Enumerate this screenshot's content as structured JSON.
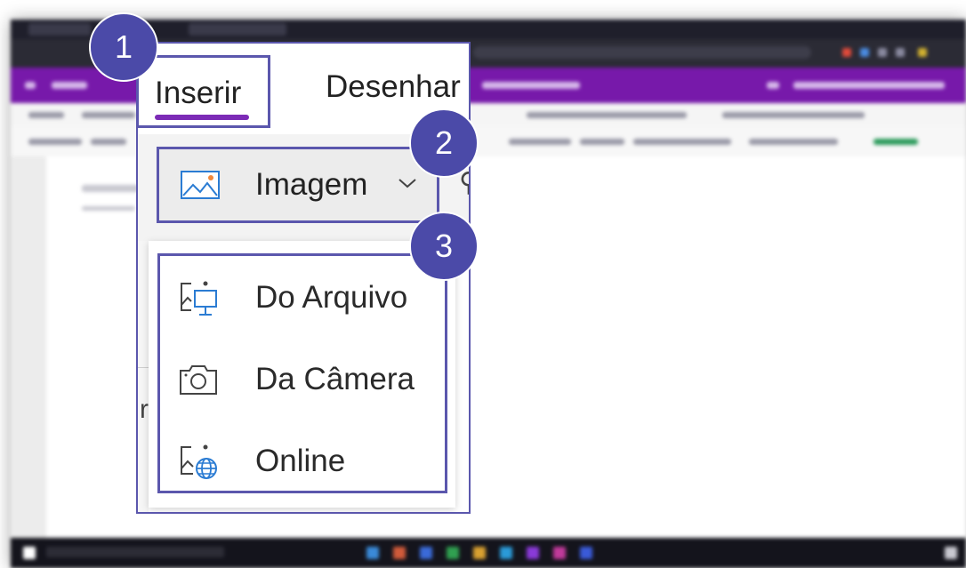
{
  "tabs": {
    "insert_label": "Inserir",
    "draw_label": "Desenhar"
  },
  "ribbon": {
    "image_button_label": "Imagem",
    "image_button_icon": "picture-icon",
    "chevron_icon": "chevron-down-icon"
  },
  "image_menu": {
    "items": [
      {
        "label": "Do Arquivo",
        "icon": "picture-from-file-icon"
      },
      {
        "label": "Da Câmera",
        "icon": "camera-icon"
      },
      {
        "label": "Online",
        "icon": "picture-online-icon"
      }
    ]
  },
  "callouts": {
    "step1": "1",
    "step2": "2",
    "step3": "3"
  },
  "colors": {
    "callout": "#4b4aa8",
    "highlight_border": "#5b57ad",
    "onenote_purple": "#7719aa",
    "tab_underline": "#7c2bb6",
    "icon_blue": "#2b7cd3",
    "icon_orange": "#f2883a"
  }
}
